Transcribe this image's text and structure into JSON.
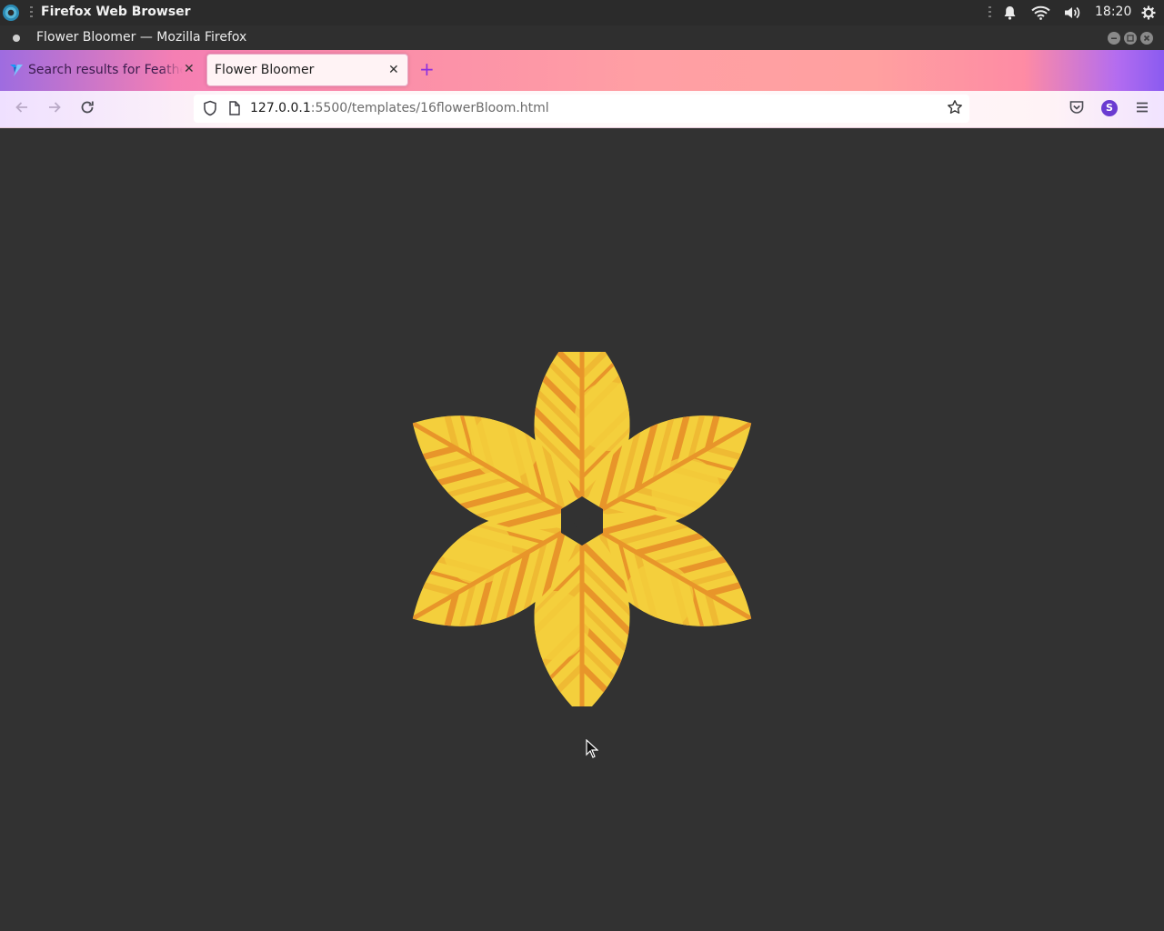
{
  "system_bar": {
    "app_name": "Firefox Web Browser",
    "clock": "18:20",
    "icons": [
      "ubuntu-activities-icon",
      "bell-icon",
      "wifi-icon",
      "volume-icon",
      "settings-gear-icon"
    ]
  },
  "window": {
    "title": "Flower Bloomer — Mozilla Firefox"
  },
  "tabs": [
    {
      "label": "Search results for Feathe",
      "active": false,
      "favicon": "vuetify-logo-icon"
    },
    {
      "label": "Flower Bloomer",
      "active": true
    }
  ],
  "navbar": {
    "url_host": "127.0.0.1",
    "url_rest": ":5500/templates/16flowerBloom.html",
    "avatar_letter": "S"
  },
  "content": {
    "background_color": "#323232",
    "flower": {
      "petal_count": 6,
      "colors": {
        "light": "#f4cf3c",
        "mid": "#efba33",
        "dark": "#e8952a",
        "center": "#323232"
      }
    }
  }
}
